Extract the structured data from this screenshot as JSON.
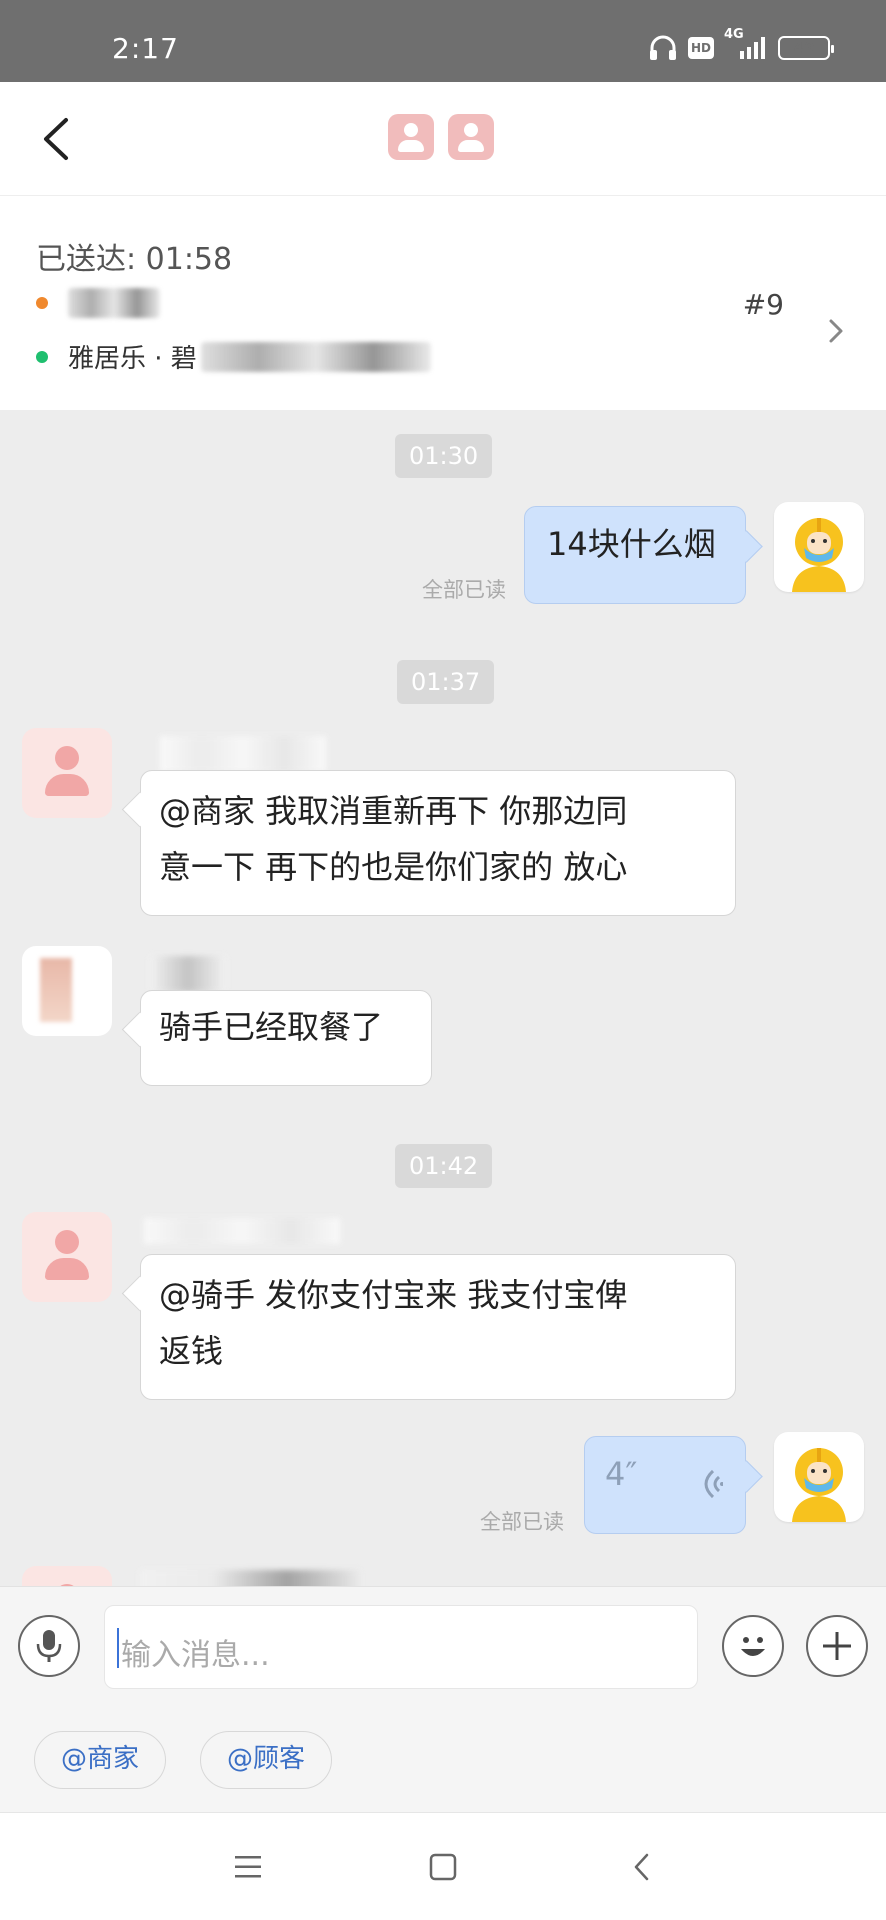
{
  "status_bar": {
    "time": "2:17",
    "hd": "HD",
    "network": "4G",
    "battery": "49"
  },
  "order": {
    "delivered_label": "已送达: 01:58",
    "shop_name_blurred": "",
    "address_prefix": "雅居乐 · 碧",
    "order_number": "#9"
  },
  "messages": {
    "t1": "01:30",
    "m1": "14块什么烟",
    "m1_read": "全部已读",
    "t2": "01:37",
    "m2_line1": "@商家  我取消重新再下   你那边同",
    "m2_line2": "意一下   再下的也是你们家的   放心",
    "m3": "骑手已经取餐了",
    "t3": "01:42",
    "m4_line1": "@骑手  发你支付宝来   我支付宝俾",
    "m4_line2": "返钱",
    "m5_duration": "4″",
    "m5_read": "全部已读"
  },
  "input": {
    "placeholder": "输入消息..."
  },
  "quick_chips": {
    "merchant": "@商家",
    "customer": "@顾客"
  },
  "colors": {
    "bubble_out": "#cfe2fc",
    "dot_shop": "#f0892e",
    "dot_addr": "#1fbf6f",
    "avatar_pink": "#f1a7a6"
  }
}
